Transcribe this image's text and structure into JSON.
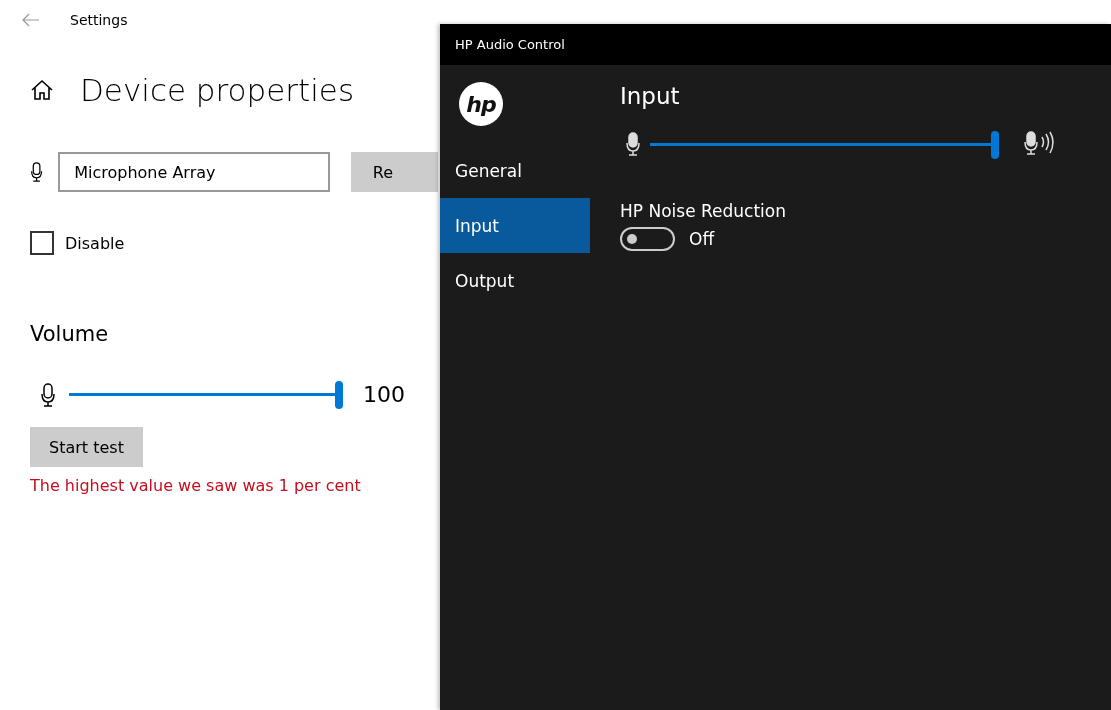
{
  "settings_window": {
    "title": "Settings",
    "heading": "Device properties",
    "device_name": {
      "value": "Microphone Array"
    },
    "rename_button": "Re",
    "disable": {
      "label": "Disable",
      "checked": false
    },
    "volume": {
      "title": "Volume",
      "level": 1,
      "reading": "100"
    },
    "test_button": "Start test",
    "test_result": "The highest value we saw was 1 per cent"
  },
  "hp_window": {
    "title": "HP Audio Control",
    "logo_text": "hp",
    "nav": [
      {
        "label": "General",
        "selected": false
      },
      {
        "label": "Input",
        "selected": true
      },
      {
        "label": "Output",
        "selected": false
      }
    ],
    "section_title": "Input",
    "input_level": {
      "level": 1
    },
    "noise_reduction": {
      "label": "HP Noise Reduction",
      "on": false,
      "state_text": "Off"
    }
  }
}
